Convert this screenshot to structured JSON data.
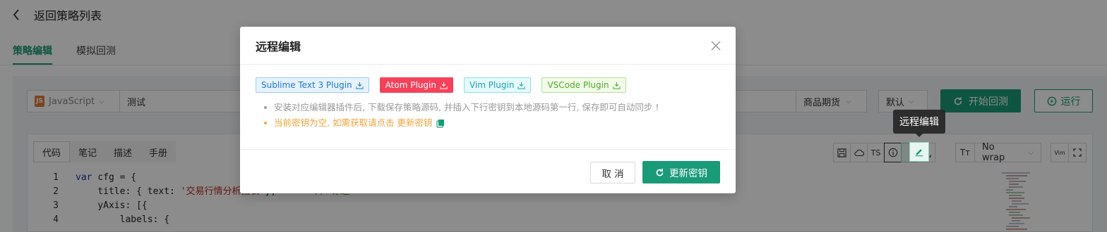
{
  "topbar": {
    "back_label": "返回策略列表"
  },
  "main_tabs": [
    {
      "label": "策略编辑"
    },
    {
      "label": "模拟回测"
    }
  ],
  "toolbar": {
    "language": "JavaScript",
    "strategy_name": "测试",
    "market": "商品期货",
    "default_select": "默认",
    "backtest_label": "开始回测",
    "run_label": "运行"
  },
  "editor": {
    "tabs": [
      {
        "label": "代码"
      },
      {
        "label": "笔记"
      },
      {
        "label": "描述"
      },
      {
        "label": "手册"
      }
    ],
    "ts_label": "TS",
    "wrap_value": "No wrap",
    "vim_label": "Vim",
    "font_label": "Tт",
    "line_numbers": [
      "1",
      "2",
      "3",
      "4"
    ],
    "code": {
      "line1_kw": "var",
      "line1_rest": " cfg = {",
      "line2_pre": "    title: { text: ",
      "line2_str": "'交易行情分析图表'",
      "line2_post": "},       ",
      "line2_comment": "// 标题",
      "line3": "    yAxis: [{",
      "line4": "        labels: {"
    }
  },
  "tooltip": {
    "text": "远程编辑"
  },
  "modal": {
    "title": "远程编辑",
    "plugins": [
      {
        "label": "Sublime Text 3 Plugin",
        "color": "#1f78d1",
        "bg": "#e6f3ff",
        "border": "#9bcaf5"
      },
      {
        "label": "Atom Plugin",
        "color": "#ffffff",
        "bg": "#f5425a",
        "border": "#f5425a"
      },
      {
        "label": "Vim Plugin",
        "color": "#17a2b8",
        "bg": "#e6fafb",
        "border": "#8fe0e8"
      },
      {
        "label": "VSCode Plugin",
        "color": "#52a82b",
        "bg": "#f1fbe8",
        "border": "#b3e09a"
      }
    ],
    "tip1": "安装对应编辑器插件后, 下载保存策略源码, 并插入下行密钥到本地源码第一行, 保存即可自动同步 !",
    "tip2": "当前密钥为空, 如需获取请点击 更新密钥",
    "cancel_label": "取 消",
    "renew_label": "更新密钥"
  },
  "colors": {
    "accent": "#1a9b77",
    "warning": "#f2a23a"
  }
}
